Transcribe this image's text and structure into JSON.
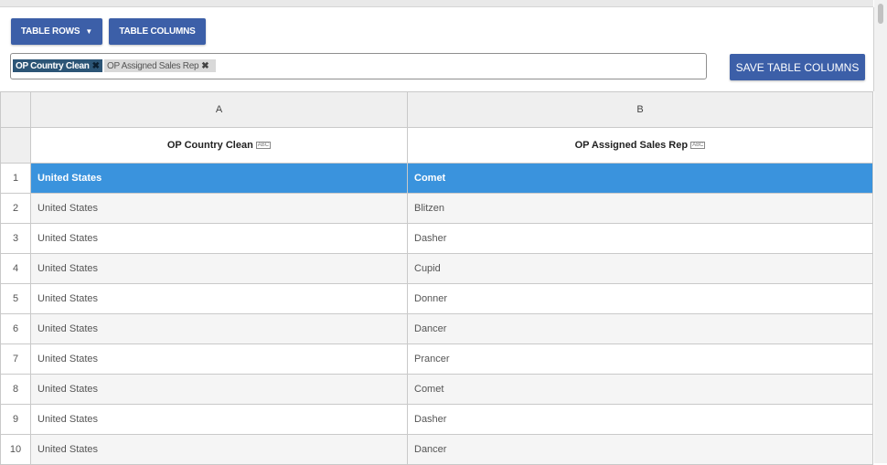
{
  "toolbar": {
    "rows_label": "TABLE ROWS",
    "columns_label": "TABLE COLUMNS",
    "save_label": "SAVE TABLE COLUMNS"
  },
  "tags": [
    {
      "label": "OP Country Clean",
      "active": true
    },
    {
      "label": "OP Assigned Sales Rep",
      "active": false
    }
  ],
  "table": {
    "column_letters": [
      "A",
      "B"
    ],
    "column_names": [
      "OP Country Clean",
      "OP Assigned Sales Rep"
    ],
    "type_badge": "ABC",
    "selected_row": 1,
    "rows": [
      {
        "num": "1",
        "a": "United States",
        "b": "Comet"
      },
      {
        "num": "2",
        "a": "United States",
        "b": "Blitzen"
      },
      {
        "num": "3",
        "a": "United States",
        "b": "Dasher"
      },
      {
        "num": "4",
        "a": "United States",
        "b": "Cupid"
      },
      {
        "num": "5",
        "a": "United States",
        "b": "Donner"
      },
      {
        "num": "6",
        "a": "United States",
        "b": "Dancer"
      },
      {
        "num": "7",
        "a": "United States",
        "b": "Prancer"
      },
      {
        "num": "8",
        "a": "United States",
        "b": "Comet"
      },
      {
        "num": "9",
        "a": "United States",
        "b": "Dasher"
      },
      {
        "num": "10",
        "a": "United States",
        "b": "Dancer"
      }
    ]
  },
  "colors": {
    "accent": "#3c5fa8",
    "selected_row": "#3a93dd",
    "active_chip": "#2c5576"
  }
}
